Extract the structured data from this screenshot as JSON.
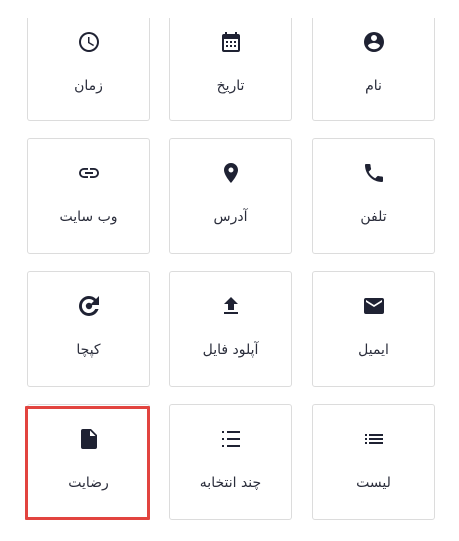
{
  "fields": [
    {
      "row": 0,
      "col": 0,
      "label": "زمان",
      "icon": "clock-icon"
    },
    {
      "row": 0,
      "col": 1,
      "label": "تاریخ",
      "icon": "calendar-icon"
    },
    {
      "row": 0,
      "col": 2,
      "label": "نام",
      "icon": "account-circle-icon"
    },
    {
      "row": 1,
      "col": 0,
      "label": "وب سایت",
      "icon": "link-icon"
    },
    {
      "row": 1,
      "col": 1,
      "label": "آدرس",
      "icon": "location-pin-icon"
    },
    {
      "row": 1,
      "col": 2,
      "label": "تلفن",
      "icon": "phone-icon"
    },
    {
      "row": 2,
      "col": 0,
      "label": "کپچا",
      "icon": "captcha-icon"
    },
    {
      "row": 2,
      "col": 1,
      "label": "آپلود فایل",
      "icon": "upload-icon"
    },
    {
      "row": 2,
      "col": 2,
      "label": "ایمیل",
      "icon": "email-icon"
    },
    {
      "row": 3,
      "col": 0,
      "label": "رضایت",
      "icon": "document-icon"
    },
    {
      "row": 3,
      "col": 1,
      "label": "چند انتخابه",
      "icon": "checklist-icon"
    },
    {
      "row": 3,
      "col": 2,
      "label": "لیست",
      "icon": "list-icon"
    }
  ],
  "selected_label": "رضایت",
  "colors": {
    "icon": "#1f2233",
    "border": "#dcdcdc",
    "selection": "#e2443f"
  }
}
